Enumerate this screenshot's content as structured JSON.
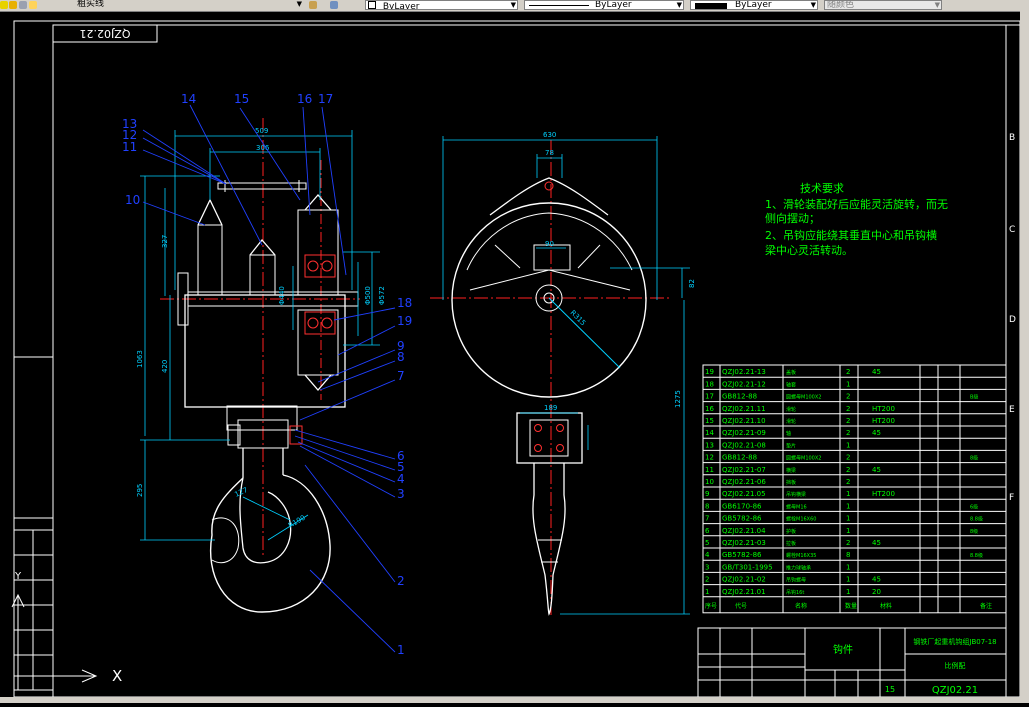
{
  "toolbar": {
    "layer_name": "粗实线",
    "color_control": "ByLayer",
    "linetype_control": "ByLayer",
    "lineweight_control": "ByLayer",
    "plotstyle_control": "随颜色"
  },
  "drawing": {
    "title_code_mirrored": "QZJ02.21",
    "title_code": "QZJ02.21",
    "part_name": "钩件",
    "title_note": "钢铁厂起重机钩组JB07-18",
    "title_material": "比例配",
    "qty_value": "15",
    "ucs_x": "X",
    "ucs_y": "Y",
    "scale_marker": "1:1",
    "tech_title": "技术要求",
    "tech_lines": [
      "1、滑轮装配好后应能灵活旋转，而无",
      "侧向摆动；",
      "2、吊钩应能绕其垂直中心和吊钩横",
      "梁中心灵活转动。"
    ],
    "side_letters": [
      "B",
      "C",
      "D",
      "E",
      "F"
    ],
    "callouts_left": [
      "13",
      "12",
      "11",
      "10",
      "14",
      "15",
      "16",
      "17"
    ],
    "callouts_right": [
      "18",
      "19",
      "9",
      "8",
      "7",
      "6",
      "5",
      "4",
      "3",
      "2",
      "1"
    ],
    "dims_side": [
      "509",
      "306",
      "327",
      "1063",
      "420",
      "295",
      "127",
      "R190",
      "Φ500",
      "Φ572",
      "Φ440"
    ],
    "dims_front": [
      "630",
      "78",
      "90",
      "82",
      "R315",
      "189",
      "1275"
    ],
    "bom": [
      {
        "no": "19",
        "code": "QZJ02.21-13",
        "name": "盖板",
        "qty": "2",
        "wt": "45",
        "note": ""
      },
      {
        "no": "18",
        "code": "QZJ02.21-12",
        "name": "轴套",
        "qty": "1",
        "wt": "",
        "note": ""
      },
      {
        "no": "17",
        "code": "GB812-88",
        "name": "圆螺母M100X2",
        "qty": "2",
        "wt": "",
        "note": "B级"
      },
      {
        "no": "16",
        "code": "QZJ02.21.11",
        "name": "滑轮",
        "qty": "2",
        "wt": "HT200",
        "note": ""
      },
      {
        "no": "15",
        "code": "QZJ02.21.10",
        "name": "滑轮",
        "qty": "2",
        "wt": "HT200",
        "note": ""
      },
      {
        "no": "14",
        "code": "QZJ02.21-09",
        "name": "轴",
        "qty": "2",
        "wt": "45",
        "note": ""
      },
      {
        "no": "13",
        "code": "QZJ02.21-08",
        "name": "垫片",
        "qty": "1",
        "wt": "",
        "note": ""
      },
      {
        "no": "12",
        "code": "GB812-88",
        "name": "圆螺母M100X2",
        "qty": "2",
        "wt": "",
        "note": "8级"
      },
      {
        "no": "11",
        "code": "QZJ02.21-07",
        "name": "横梁",
        "qty": "2",
        "wt": "45",
        "note": ""
      },
      {
        "no": "10",
        "code": "QZJ02.21-06",
        "name": "挡板",
        "qty": "2",
        "wt": "",
        "note": ""
      },
      {
        "no": "9",
        "code": "QZJ02.21.05",
        "name": "吊钩横梁",
        "qty": "1",
        "wt": "HT200",
        "note": ""
      },
      {
        "no": "8",
        "code": "GB6170-86",
        "name": "螺母M16",
        "qty": "1",
        "wt": "",
        "note": "6级"
      },
      {
        "no": "7",
        "code": "GB5782-86",
        "name": "螺栓M16X60",
        "qty": "1",
        "wt": "",
        "note": "8.8级"
      },
      {
        "no": "6",
        "code": "QZJ02.21.04",
        "name": "护板",
        "qty": "1",
        "wt": "",
        "note": "8级"
      },
      {
        "no": "5",
        "code": "QZJ02.21-03",
        "name": "拉板",
        "qty": "2",
        "wt": "45",
        "note": ""
      },
      {
        "no": "4",
        "code": "GB5782-86",
        "name": "螺栓M16X35",
        "qty": "8",
        "wt": "",
        "note": "8.8级"
      },
      {
        "no": "3",
        "code": "GB/T301-1995",
        "name": "推力球轴承",
        "qty": "1",
        "wt": "",
        "note": ""
      },
      {
        "no": "2",
        "code": "QZJ02.21-02",
        "name": "吊钩螺母",
        "qty": "1",
        "wt": "45",
        "note": ""
      },
      {
        "no": "1",
        "code": "QZJ02.21.01",
        "name": "吊钩16t",
        "qty": "1",
        "wt": "20",
        "note": ""
      }
    ],
    "bom_header": [
      "序号",
      "代号",
      "名称",
      "数量",
      "材料",
      "备注"
    ]
  }
}
